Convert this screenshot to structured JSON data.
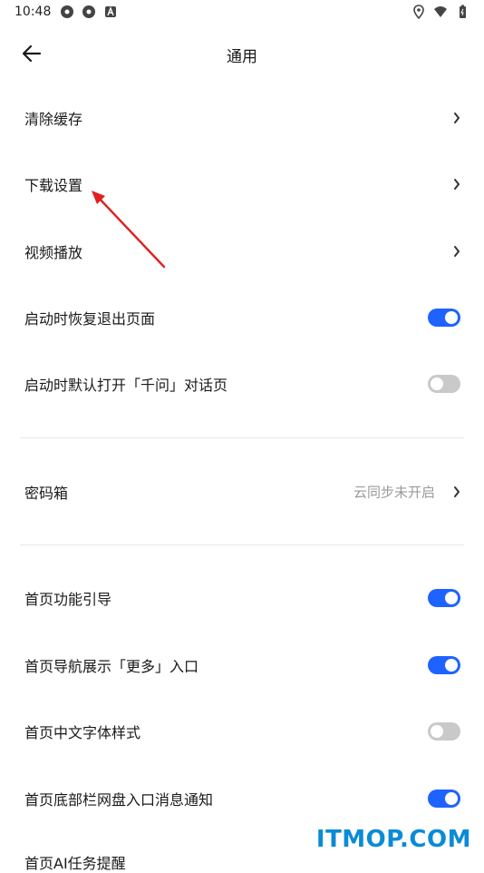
{
  "status_bar": {
    "time": "10:48"
  },
  "header": {
    "title": "通用"
  },
  "rows": [
    {
      "label": "清除缓存",
      "type": "link"
    },
    {
      "label": "下载设置",
      "type": "link"
    },
    {
      "label": "视频播放",
      "type": "link"
    },
    {
      "label": "启动时恢复退出页面",
      "type": "toggle",
      "enabled": true
    },
    {
      "label": "启动时默认打开「千问」对话页",
      "type": "toggle",
      "enabled": false
    },
    {
      "label": "密码箱",
      "type": "link",
      "value": "云同步未开启"
    },
    {
      "label": "首页功能引导",
      "type": "toggle",
      "enabled": true
    },
    {
      "label": "首页导航展示「更多」入口",
      "type": "toggle",
      "enabled": true
    },
    {
      "label": "首页中文字体样式",
      "type": "toggle",
      "enabled": false
    },
    {
      "label": "首页底部栏网盘入口消息通知",
      "type": "toggle",
      "enabled": true
    }
  ],
  "partial_row": {
    "label": "首页AI任务提醒"
  },
  "watermark": "ITMOP.COM",
  "colors": {
    "toggle_on": "#1e63ff",
    "toggle_off": "#c9c9c9",
    "annotation_arrow": "#e02020"
  },
  "icons": [
    "android-status-icon",
    "android-status-icon",
    "a-notification-icon",
    "location-icon",
    "wifi-icon",
    "battery-icon",
    "back-arrow-icon",
    "chevron-right-icon"
  ]
}
